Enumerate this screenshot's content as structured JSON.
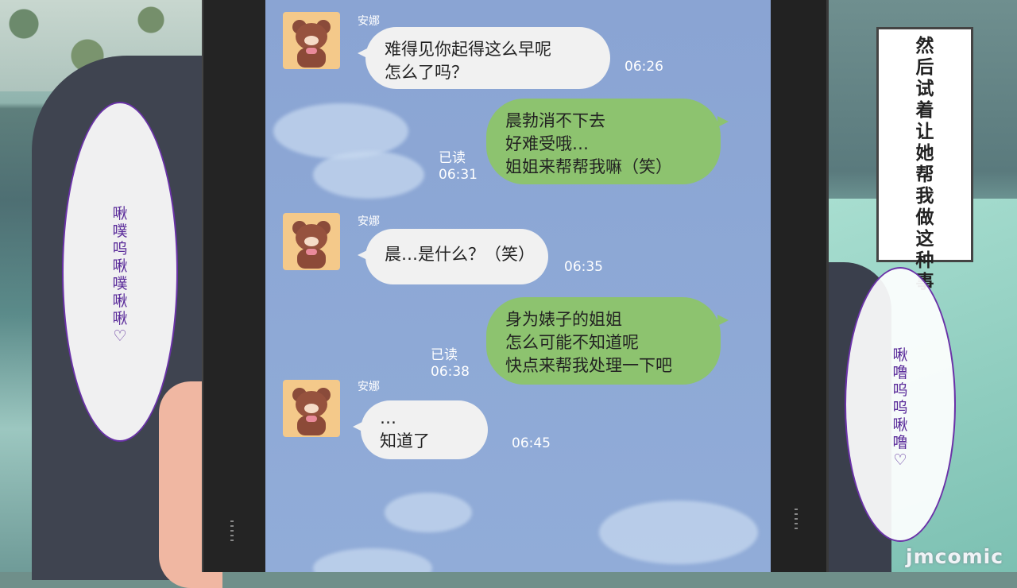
{
  "chat": {
    "messages": [
      {
        "sender": "安娜",
        "lines": [
          "难得见你起得这么早呢",
          "怎么了吗？"
        ],
        "time": "06:26"
      },
      {
        "read": "已读",
        "lines": [
          "晨勃消不下去",
          "好难受哦…",
          "姐姐来帮帮我嘛（笑）"
        ],
        "time": "06:31"
      },
      {
        "sender": "安娜",
        "lines": [
          "晨…是什么？（笑）"
        ],
        "time": "06:35"
      },
      {
        "read": "已读",
        "lines": [
          "身为婊子的姐姐",
          "怎么可能不知道呢",
          "快点来帮我处理一下吧"
        ],
        "time": "06:38"
      },
      {
        "sender": "安娜",
        "lines": [
          "…",
          "知道了"
        ],
        "time": "06:45"
      }
    ]
  },
  "narration": "然后试着让她帮我做这种事",
  "sfx_left": "啾噗呜啾噗啾啾♡",
  "sfx_right": "啾噜呜呜啾噜♡",
  "watermark": "jmcomic",
  "colors": {
    "incoming_bubble": "#f1f1f1",
    "outgoing_bubble": "#8dc36f",
    "screen": "#8ea9d6",
    "sfx_text": "#5a2b9a"
  }
}
